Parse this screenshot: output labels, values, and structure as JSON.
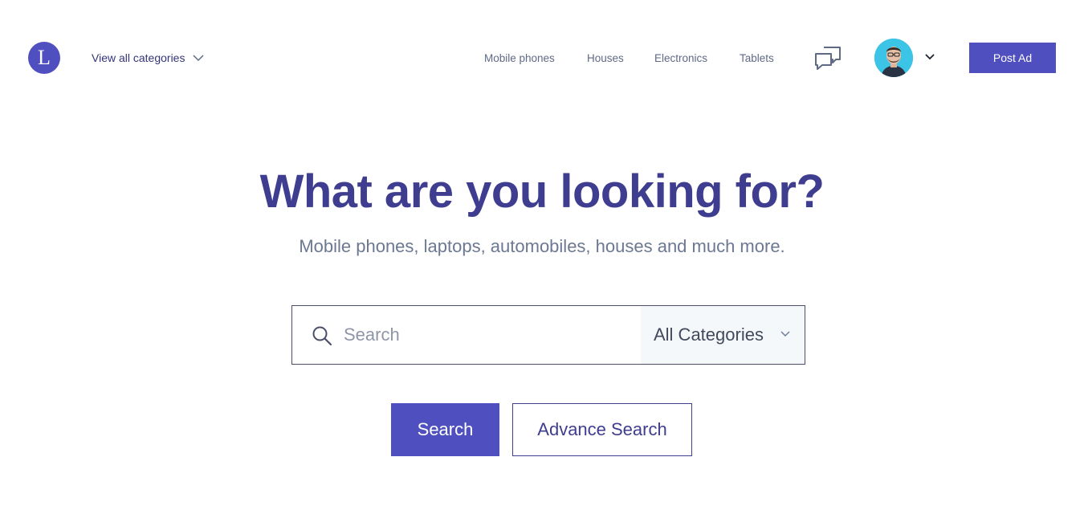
{
  "brand": {
    "logo_letter": "L",
    "color": "#4f4fbf"
  },
  "header": {
    "categories_toggle": {
      "label": "View all categories",
      "icon": "chevron-down-icon"
    },
    "nav": [
      {
        "label": "Mobile phones"
      },
      {
        "label": "Houses"
      },
      {
        "label": "Electronics"
      },
      {
        "label": "Tablets"
      }
    ],
    "messages_icon": "chat-bubbles-icon",
    "user_menu_icon": "chevron-down-icon",
    "post_ad_label": "Post Ad"
  },
  "hero": {
    "title": "What are you looking for?",
    "subtitle": "Mobile phones, laptops, automobiles, houses and much more."
  },
  "search": {
    "placeholder": "Search",
    "value": "",
    "category_selected": "All Categories",
    "search_button": "Search",
    "advance_button": "Advance Search"
  },
  "colors": {
    "accent": "#4f4fbf",
    "title": "#3f3d8f",
    "subtitle": "#6c7891",
    "nav_text": "#5f6a85"
  }
}
